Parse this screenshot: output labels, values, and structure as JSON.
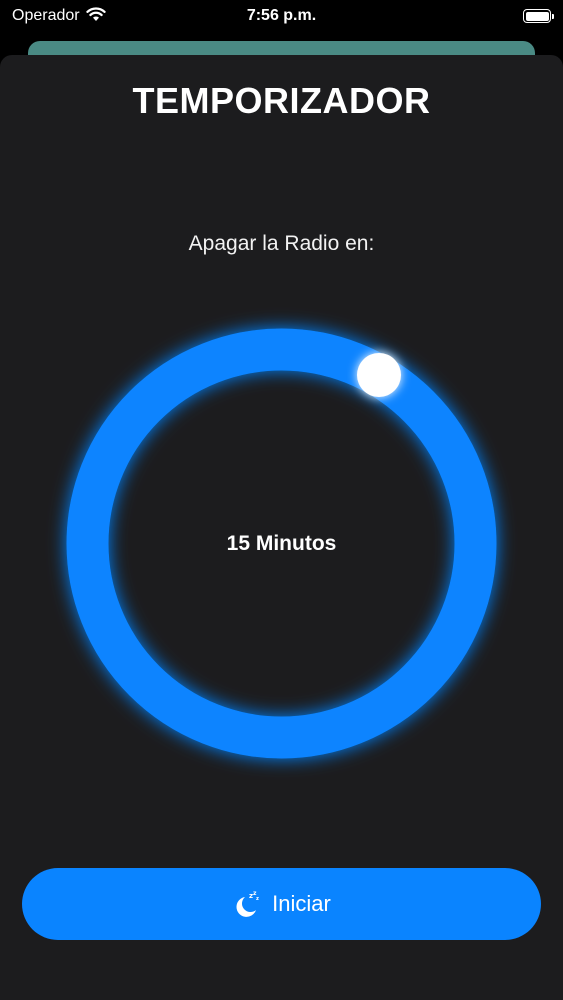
{
  "status_bar": {
    "carrier": "Operador",
    "time": "7:56 p.m."
  },
  "header": {
    "title": "TEMPORIZADOR"
  },
  "timer": {
    "prompt": "Apagar la Radio en:",
    "value_label": "15 Minutos",
    "ring_color": "#0a84ff",
    "knob_color": "#ffffff"
  },
  "start": {
    "label": "Iniciar",
    "icon": "moon-sleep-icon",
    "color": "#0a84ff"
  },
  "colors": {
    "background": "#1c1c1e",
    "accent": "#0a84ff",
    "behind_card": "#4a8a84"
  }
}
